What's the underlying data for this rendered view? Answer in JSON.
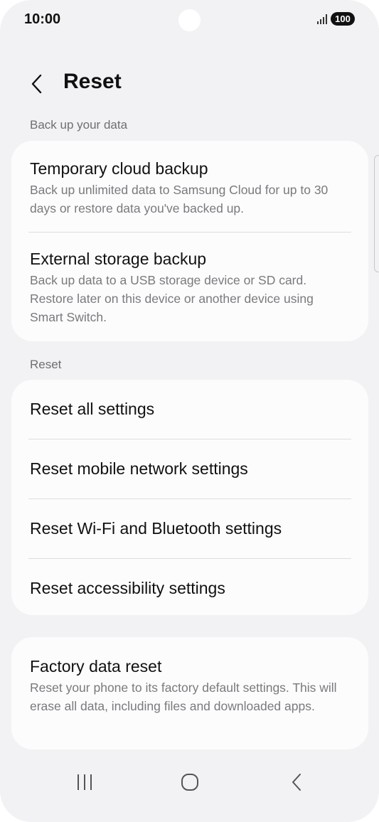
{
  "status_bar": {
    "time": "10:00",
    "battery": "100",
    "icons": [
      "signal-icon",
      "battery-icon"
    ]
  },
  "header": {
    "title": "Reset",
    "back_icon": "chevron-left-icon"
  },
  "backup_section": {
    "label": "Back up your data",
    "items": [
      {
        "title": "Temporary cloud backup",
        "desc": "Back up unlimited data to Samsung Cloud for up to 30 days or restore data you've backed up."
      },
      {
        "title": "External storage backup",
        "desc": "Back up data to a USB storage device or SD card. Restore later on this device or another device using Smart Switch."
      }
    ]
  },
  "reset_section": {
    "label": "Reset",
    "items": [
      {
        "title": "Reset all settings"
      },
      {
        "title": "Reset mobile network settings"
      },
      {
        "title": "Reset Wi-Fi and Bluetooth settings"
      },
      {
        "title": "Reset accessibility settings"
      }
    ]
  },
  "factory_section": {
    "title": "Factory data reset",
    "desc": "Reset your phone to its factory default settings. This will erase all data, including files and downloaded apps."
  },
  "nav_bar": {
    "icons": [
      "recent-apps-icon",
      "home-icon",
      "back-icon"
    ]
  }
}
